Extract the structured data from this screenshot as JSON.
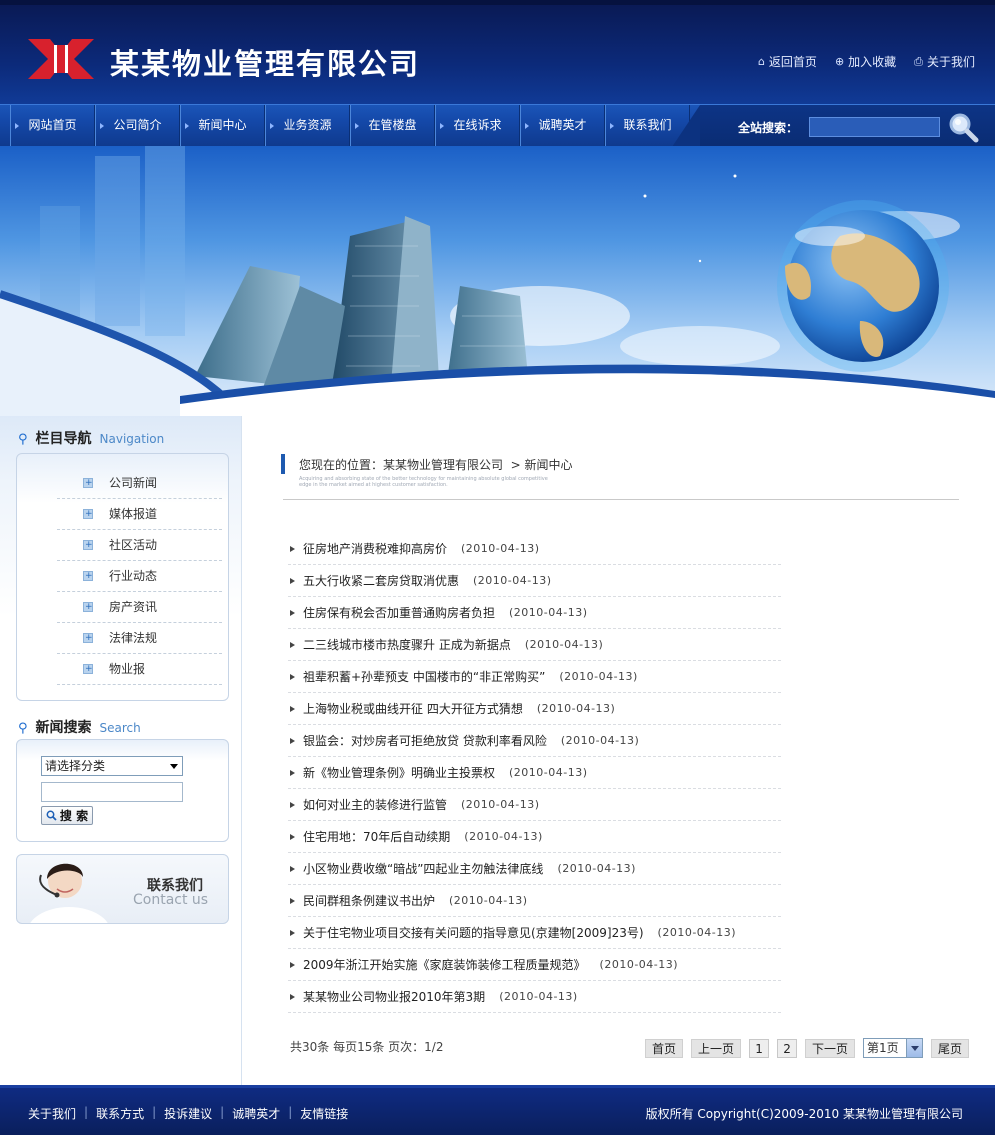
{
  "header": {
    "company_name": "某某物业管理有限公司",
    "top_links": [
      {
        "label": "返回首页",
        "icon": "home-icon"
      },
      {
        "label": "加入收藏",
        "icon": "favorite-icon"
      },
      {
        "label": "关于我们",
        "icon": "about-icon"
      }
    ]
  },
  "nav": {
    "items": [
      "网站首页",
      "公司简介",
      "新闻中心",
      "业务资源",
      "在管楼盘",
      "在线诉求",
      "诚聘英才",
      "联系我们"
    ],
    "search_label": "全站搜索："
  },
  "sidebar": {
    "category_title": "栏目导航",
    "category_title_en": "Navigation",
    "categories": [
      "公司新闻",
      "媒体报道",
      "社区活动",
      "行业动态",
      "房产资讯",
      "法律法规",
      "物业报"
    ],
    "search_title": "新闻搜索",
    "search_title_en": "Search",
    "select_value": "请选择分类",
    "search_button": "搜 索",
    "contact_zh": "联系我们",
    "contact_en": "Contact us"
  },
  "content": {
    "location_prefix": "您现在的位置：",
    "location_home": "某某物业管理有限公司",
    "location_current": "> 新闻中心",
    "location_sub": "Acquiring and absorbing state of the better technology for maintaining absolute global competitive edge in the market aimed at highest customer satisfaction.",
    "news": [
      {
        "title": "征房地产消费税难抑高房价",
        "date": "(2010-04-13)"
      },
      {
        "title": "五大行收紧二套房贷取消优惠",
        "date": "(2010-04-13)"
      },
      {
        "title": "住房保有税会否加重普通购房者负担",
        "date": "(2010-04-13)"
      },
      {
        "title": "二三线城市楼市热度骤升 正成为新据点",
        "date": "(2010-04-13)"
      },
      {
        "title": "祖辈积蓄+孙辈预支 中国楼市的“非正常购买”",
        "date": "(2010-04-13)"
      },
      {
        "title": "上海物业税或曲线开征 四大开征方式猜想",
        "date": "(2010-04-13)"
      },
      {
        "title": "银监会：对炒房者可拒绝放贷 贷款利率看风险",
        "date": "(2010-04-13)"
      },
      {
        "title": "新《物业管理条例》明确业主投票权",
        "date": "(2010-04-13)"
      },
      {
        "title": "如何对业主的装修进行监管",
        "date": "(2010-04-13)"
      },
      {
        "title": "住宅用地：70年后自动续期",
        "date": "(2010-04-13)"
      },
      {
        "title": "小区物业费收缴“暗战”四起业主勿触法律底线",
        "date": "(2010-04-13)"
      },
      {
        "title": "民间群租条例建议书出炉",
        "date": "(2010-04-13)"
      },
      {
        "title": "关于住宅物业项目交接有关问题的指导意见(京建物[2009]23号)",
        "date": "(2010-04-13)"
      },
      {
        "title": "2009年浙江开始实施《家庭装饰装修工程质量规范》",
        "date": "(2010-04-13)"
      },
      {
        "title": "某某物业公司物业报2010年第3期",
        "date": "(2010-04-13)"
      }
    ],
    "pager_info": "共30条  每页15条  页次：1/2",
    "pager": {
      "first": "首页",
      "prev": "上一页",
      "pages": [
        "1",
        "2"
      ],
      "next": "下一页",
      "select_value": "第1页",
      "last": "尾页"
    }
  },
  "footer": {
    "links": [
      "关于我们",
      "联系方式",
      "投诉建议",
      "诚聘英才",
      "友情链接"
    ],
    "copyright": "版权所有  Copyright(C)2009-2010 某某物业管理有限公司"
  },
  "colors": {
    "header_dark": "#0a1a55",
    "nav_blue": "#1448a8",
    "accent": "#1e5ab0"
  }
}
